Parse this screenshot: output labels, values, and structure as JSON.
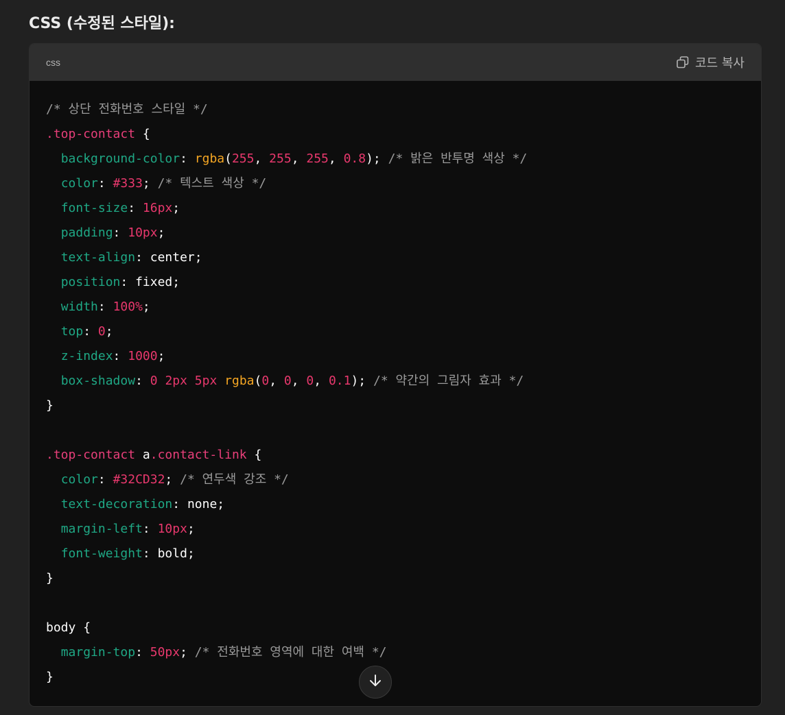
{
  "heading": "CSS (수정된 스타일):",
  "code_block": {
    "language": "css",
    "copy_label": "코드 복사",
    "lines": [
      [
        [
          "comment",
          "/* 상단 전화번호 스타일 */"
        ]
      ],
      [
        [
          "selector",
          ".top-contact"
        ],
        [
          "punct",
          " {"
        ]
      ],
      [
        [
          "punct",
          "  "
        ],
        [
          "prop",
          "background-color"
        ],
        [
          "punct",
          ": "
        ],
        [
          "fn",
          "rgba"
        ],
        [
          "punct",
          "("
        ],
        [
          "num",
          "255"
        ],
        [
          "punct",
          ", "
        ],
        [
          "num",
          "255"
        ],
        [
          "punct",
          ", "
        ],
        [
          "num",
          "255"
        ],
        [
          "punct",
          ", "
        ],
        [
          "num",
          "0.8"
        ],
        [
          "punct",
          "); "
        ],
        [
          "comment",
          "/* 밝은 반투명 색상 */"
        ]
      ],
      [
        [
          "punct",
          "  "
        ],
        [
          "prop",
          "color"
        ],
        [
          "punct",
          ": "
        ],
        [
          "num",
          "#333"
        ],
        [
          "punct",
          "; "
        ],
        [
          "comment",
          "/* 텍스트 색상 */"
        ]
      ],
      [
        [
          "punct",
          "  "
        ],
        [
          "prop",
          "font-size"
        ],
        [
          "punct",
          ": "
        ],
        [
          "num",
          "16px"
        ],
        [
          "punct",
          ";"
        ]
      ],
      [
        [
          "punct",
          "  "
        ],
        [
          "prop",
          "padding"
        ],
        [
          "punct",
          ": "
        ],
        [
          "num",
          "10px"
        ],
        [
          "punct",
          ";"
        ]
      ],
      [
        [
          "punct",
          "  "
        ],
        [
          "prop",
          "text-align"
        ],
        [
          "punct",
          ": "
        ],
        [
          "kw",
          "center"
        ],
        [
          "punct",
          ";"
        ]
      ],
      [
        [
          "punct",
          "  "
        ],
        [
          "prop",
          "position"
        ],
        [
          "punct",
          ": "
        ],
        [
          "kw",
          "fixed"
        ],
        [
          "punct",
          ";"
        ]
      ],
      [
        [
          "punct",
          "  "
        ],
        [
          "prop",
          "width"
        ],
        [
          "punct",
          ": "
        ],
        [
          "num",
          "100%"
        ],
        [
          "punct",
          ";"
        ]
      ],
      [
        [
          "punct",
          "  "
        ],
        [
          "prop",
          "top"
        ],
        [
          "punct",
          ": "
        ],
        [
          "num",
          "0"
        ],
        [
          "punct",
          ";"
        ]
      ],
      [
        [
          "punct",
          "  "
        ],
        [
          "prop",
          "z-index"
        ],
        [
          "punct",
          ": "
        ],
        [
          "num",
          "1000"
        ],
        [
          "punct",
          ";"
        ]
      ],
      [
        [
          "punct",
          "  "
        ],
        [
          "prop",
          "box-shadow"
        ],
        [
          "punct",
          ": "
        ],
        [
          "num",
          "0"
        ],
        [
          "punct",
          " "
        ],
        [
          "num",
          "2px"
        ],
        [
          "punct",
          " "
        ],
        [
          "num",
          "5px"
        ],
        [
          "punct",
          " "
        ],
        [
          "fn",
          "rgba"
        ],
        [
          "punct",
          "("
        ],
        [
          "num",
          "0"
        ],
        [
          "punct",
          ", "
        ],
        [
          "num",
          "0"
        ],
        [
          "punct",
          ", "
        ],
        [
          "num",
          "0"
        ],
        [
          "punct",
          ", "
        ],
        [
          "num",
          "0.1"
        ],
        [
          "punct",
          "); "
        ],
        [
          "comment",
          "/* 약간의 그림자 효과 */"
        ]
      ],
      [
        [
          "punct",
          "}"
        ]
      ],
      [],
      [
        [
          "selector",
          ".top-contact"
        ],
        [
          "kw",
          " a"
        ],
        [
          "selector",
          ".contact-link"
        ],
        [
          "punct",
          " {"
        ]
      ],
      [
        [
          "punct",
          "  "
        ],
        [
          "prop",
          "color"
        ],
        [
          "punct",
          ": "
        ],
        [
          "num",
          "#32CD32"
        ],
        [
          "punct",
          "; "
        ],
        [
          "comment",
          "/* 연두색 강조 */"
        ]
      ],
      [
        [
          "punct",
          "  "
        ],
        [
          "prop",
          "text-decoration"
        ],
        [
          "punct",
          ": "
        ],
        [
          "kw",
          "none"
        ],
        [
          "punct",
          ";"
        ]
      ],
      [
        [
          "punct",
          "  "
        ],
        [
          "prop",
          "margin-left"
        ],
        [
          "punct",
          ": "
        ],
        [
          "num",
          "10px"
        ],
        [
          "punct",
          ";"
        ]
      ],
      [
        [
          "punct",
          "  "
        ],
        [
          "prop",
          "font-weight"
        ],
        [
          "punct",
          ": "
        ],
        [
          "kw",
          "bold"
        ],
        [
          "punct",
          ";"
        ]
      ],
      [
        [
          "punct",
          "}"
        ]
      ],
      [],
      [
        [
          "kw",
          "body"
        ],
        [
          "punct",
          " {"
        ]
      ],
      [
        [
          "punct",
          "  "
        ],
        [
          "prop",
          "margin-top"
        ],
        [
          "punct",
          ": "
        ],
        [
          "num",
          "50px"
        ],
        [
          "punct",
          "; "
        ],
        [
          "comment",
          "/* 전화번호 영역에 대한 여백 */"
        ]
      ],
      [
        [
          "punct",
          "}"
        ]
      ]
    ]
  },
  "icons": {
    "copy": "copy-icon",
    "scroll_down": "arrow-down-icon"
  }
}
